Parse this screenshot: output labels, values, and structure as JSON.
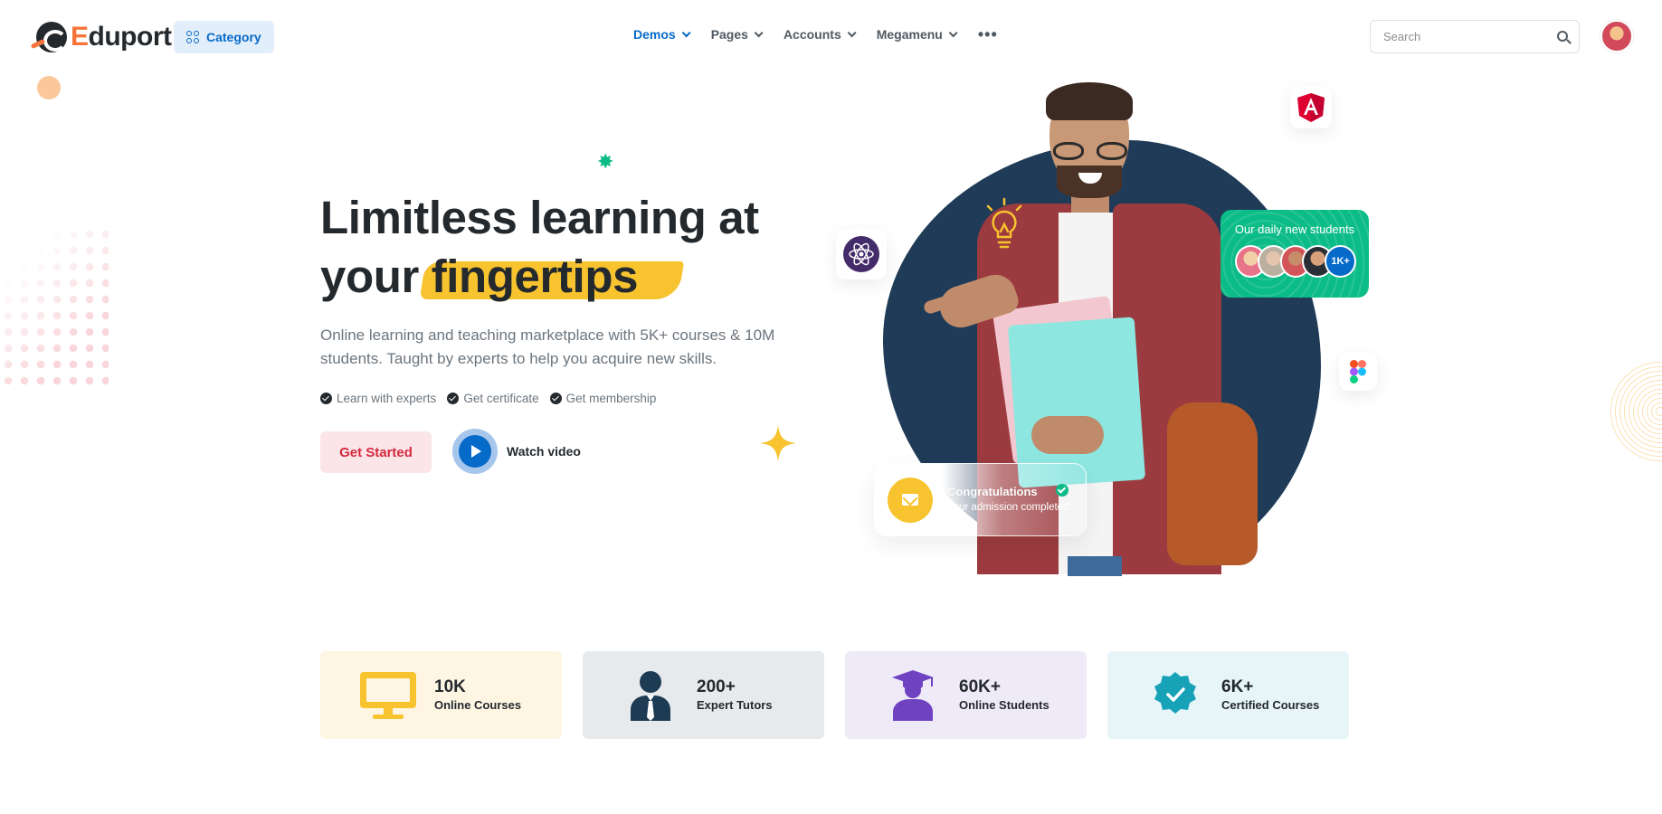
{
  "header": {
    "logo": "Eduport",
    "category_label": "Category",
    "nav": [
      {
        "label": "Demos",
        "active": true
      },
      {
        "label": "Pages",
        "active": false
      },
      {
        "label": "Accounts",
        "active": false
      },
      {
        "label": "Megamenu",
        "active": false
      }
    ],
    "more_icon": "ellipsis-icon",
    "search_placeholder": "Search"
  },
  "hero": {
    "title_line1": "Limitless learning at",
    "title_line2_prefix": "your",
    "title_highlight": "fingertips",
    "description": "Online learning and teaching marketplace with 5K+ courses & 10M students. Taught by experts to help you acquire new skills.",
    "features": [
      "Learn with experts",
      "Get certificate",
      "Get membership"
    ],
    "cta_label": "Get Started",
    "video_label": "Watch video"
  },
  "cards": {
    "students_title": "Our daily new students",
    "students_count": "1K+",
    "congrats_title": "Congratulations",
    "congrats_subtitle": "Your admission completed"
  },
  "stats": [
    {
      "value": "10K",
      "label": "Online Courses",
      "icon": "monitor-icon",
      "bg": "#fef6e3",
      "color": "#f7c32e"
    },
    {
      "value": "200+",
      "label": "Expert Tutors",
      "icon": "tutor-icon",
      "bg": "#e7eaed",
      "color": "#1d3b53"
    },
    {
      "value": "60K+",
      "label": "Online Students",
      "icon": "graduate-icon",
      "bg": "#efeaf8",
      "color": "#6f42c1"
    },
    {
      "value": "6K+",
      "label": "Certified Courses",
      "icon": "certificate-badge-icon",
      "bg": "#e7f5f8",
      "color": "#17a2b8"
    }
  ],
  "colors": {
    "primary": "#066ac9",
    "danger": "#d6293e",
    "warning": "#f7c32e",
    "success": "#0cbc87",
    "dark": "#24292d"
  }
}
